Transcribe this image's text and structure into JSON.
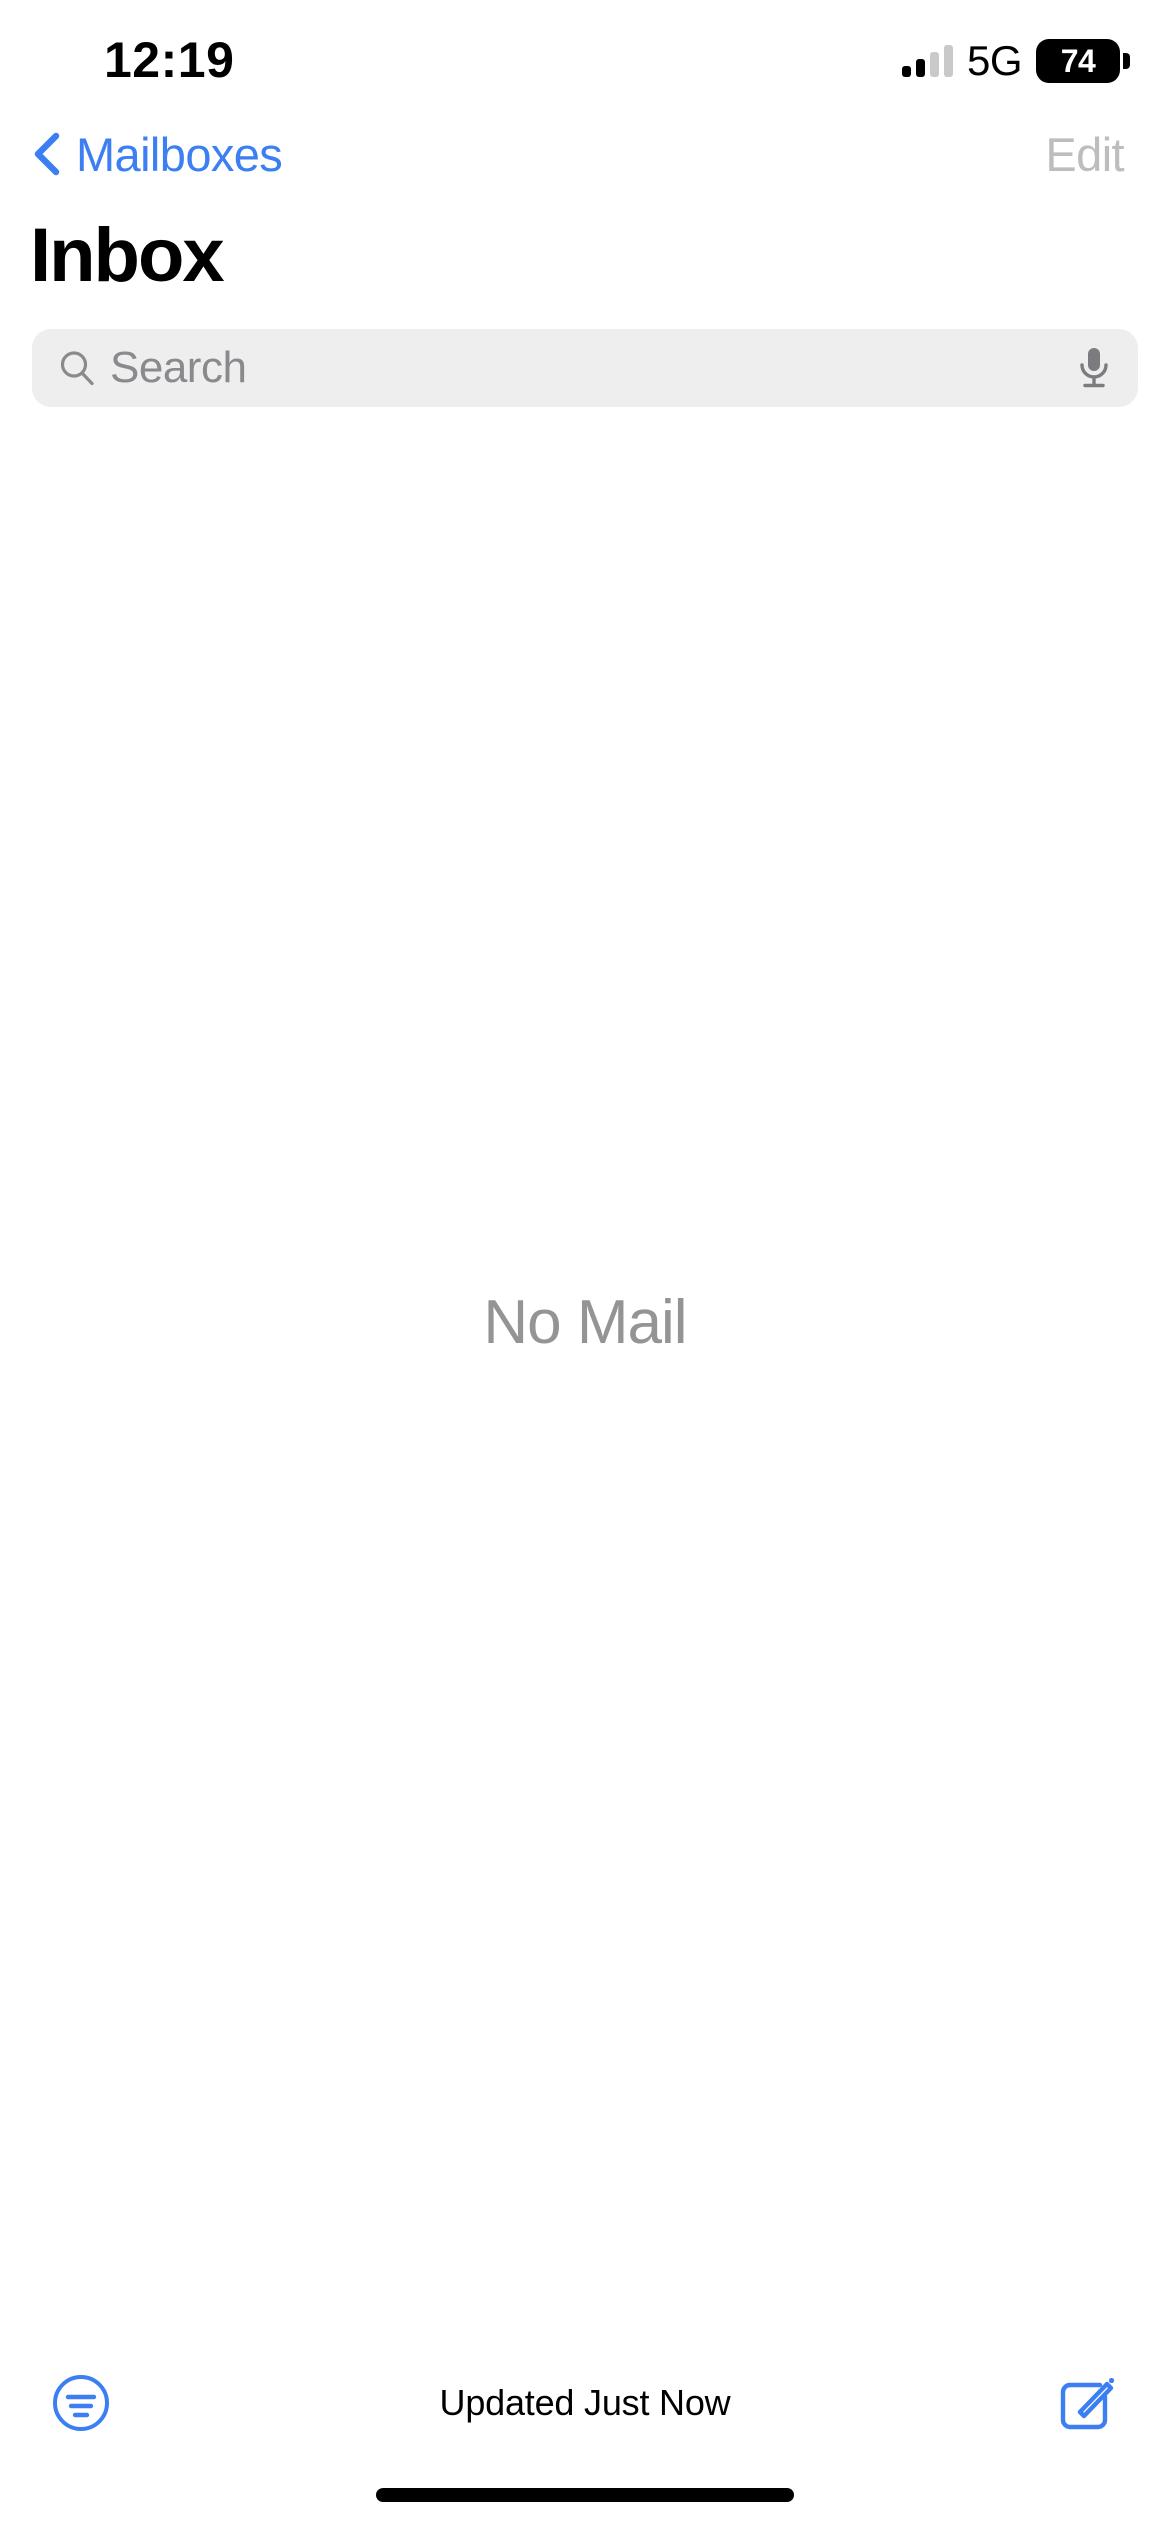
{
  "status_bar": {
    "time": "12:19",
    "network": "5G",
    "battery_level": "74",
    "signal_icon": "cellular-signal-icon",
    "battery_icon": "battery-icon"
  },
  "nav_bar": {
    "back_label": "Mailboxes",
    "back_icon": "chevron-left-icon",
    "edit_label": "Edit"
  },
  "page": {
    "title": "Inbox"
  },
  "search": {
    "placeholder": "Search",
    "search_icon": "search-icon",
    "mic_icon": "microphone-icon"
  },
  "empty_state": {
    "message": "No Mail"
  },
  "toolbar": {
    "filter_icon": "filter-icon",
    "status_text": "Updated Just Now",
    "compose_icon": "compose-icon"
  },
  "colors": {
    "accent_blue": "#3b7ff2",
    "disabled_gray": "#bdbdbd",
    "placeholder_gray": "#8a8a8e",
    "empty_gray": "#949494",
    "search_bg": "#eeeeef"
  }
}
